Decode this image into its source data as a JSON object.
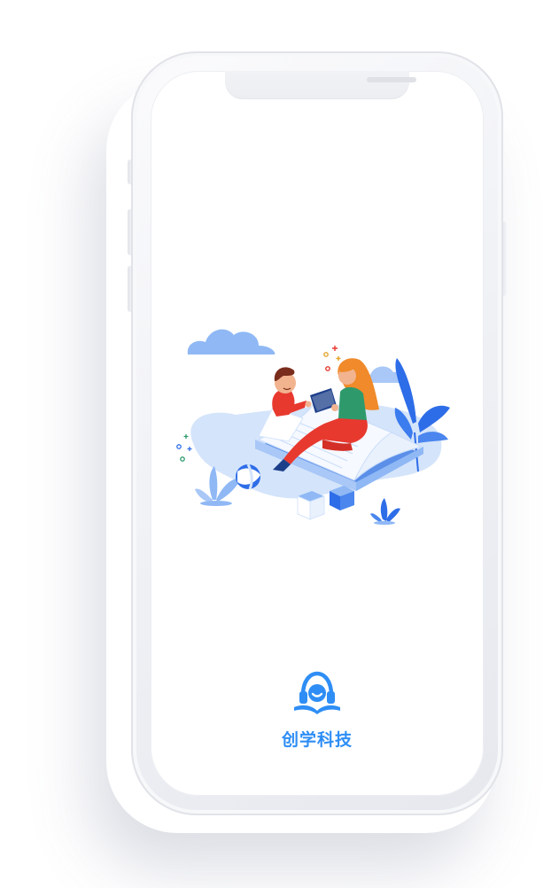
{
  "splash": {
    "brand_name": "创学科技",
    "illustration_subject": "reading-together-illustration",
    "logo_icon": "headphones-book-logo-icon"
  },
  "colors": {
    "brand_blue": "#2e8ef5",
    "light_blue": "#8fb8f5",
    "pale_blue": "#d4e4fb",
    "deep_blue": "#2e6de8",
    "red": "#e8392f",
    "green": "#2e9a6c",
    "orange_hair": "#f08a2a"
  }
}
